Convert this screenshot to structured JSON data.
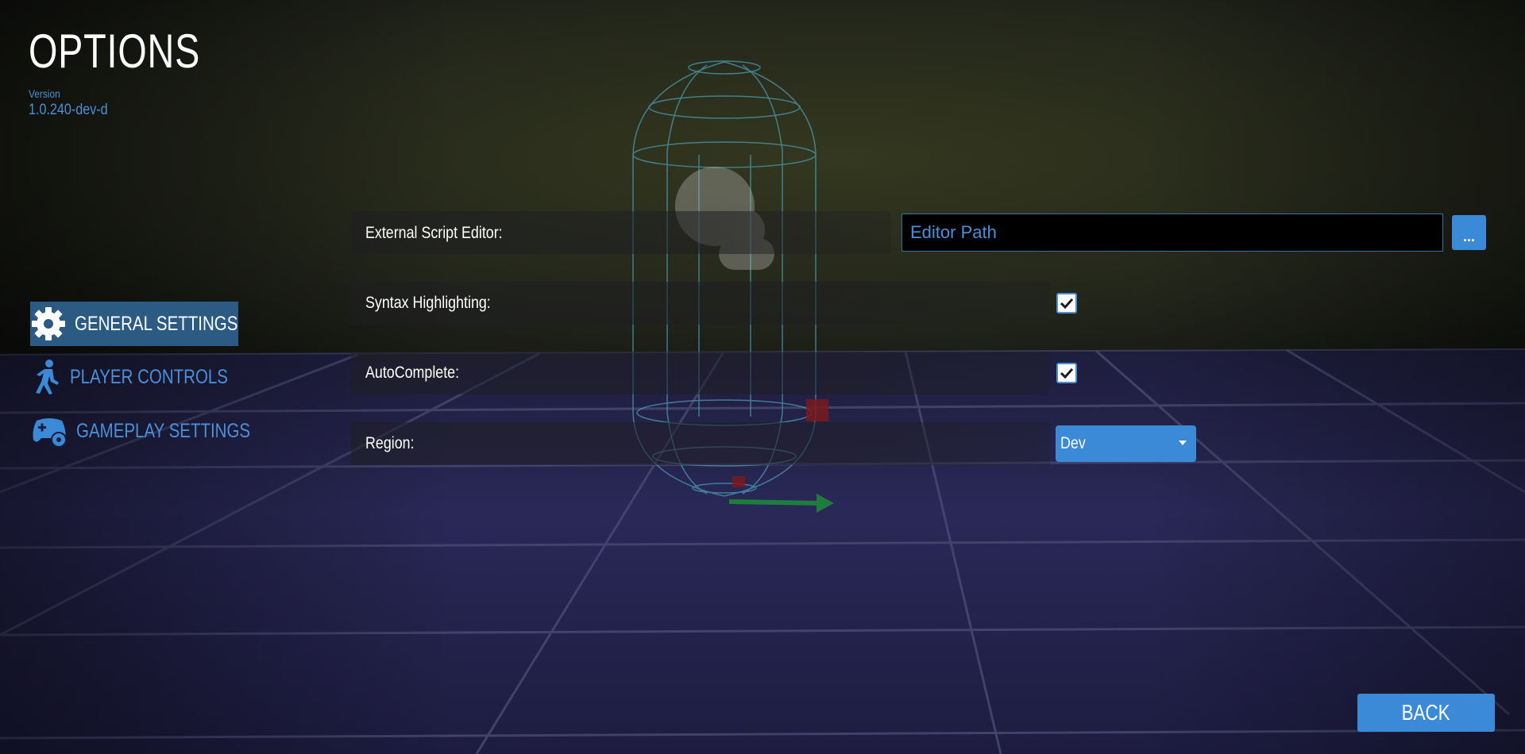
{
  "header": {
    "title": "OPTIONS",
    "version_label": "Version",
    "version_value": "1.0.240-dev-d"
  },
  "sidebar": {
    "items": [
      {
        "label": "GENERAL SETTINGS",
        "icon": "gear-icon",
        "active": true
      },
      {
        "label": "PLAYER CONTROLS",
        "icon": "running-person-icon",
        "active": false
      },
      {
        "label": "GAMEPLAY SETTINGS",
        "icon": "gamepad-gear-icon",
        "active": false
      }
    ]
  },
  "settings": {
    "external_script_editor": {
      "label": "External Script Editor:",
      "placeholder": "Editor Path",
      "browse_label": "..."
    },
    "syntax_highlighting": {
      "label": "Syntax Highlighting:",
      "checked": true
    },
    "autocomplete": {
      "label": "AutoComplete:",
      "checked": true
    },
    "region": {
      "label": "Region:",
      "value": "Dev"
    }
  },
  "footer": {
    "back_label": "BACK"
  },
  "colors": {
    "accent": "#3a8ad8",
    "accent_text": "#4a90d9",
    "active_nav_bg": "#2b5a82",
    "wall": "#2a2d1a",
    "floor": "#242246"
  }
}
